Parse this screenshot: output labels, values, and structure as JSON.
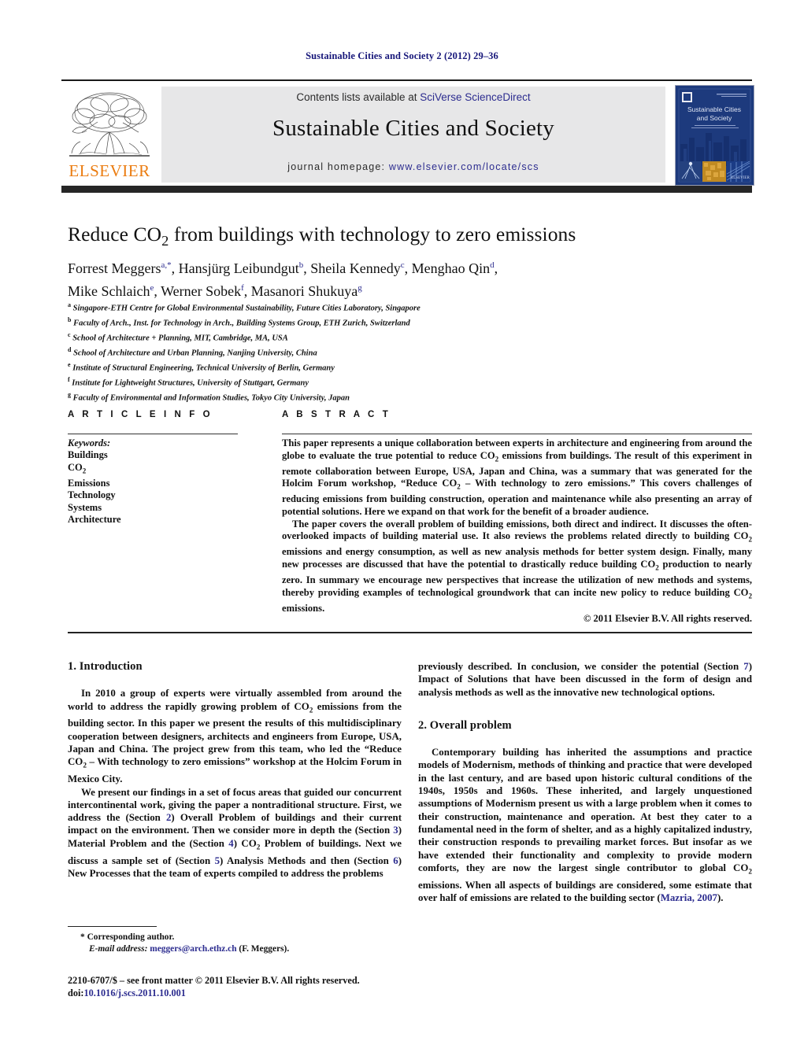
{
  "running_head": "Sustainable Cities and Society 2 (2012) 29–36",
  "header": {
    "contents_text": "Contents lists available at ",
    "sciverse_link": "SciVerse ScienceDirect",
    "journal_name": "Sustainable Cities and Society",
    "homepage_label": "journal homepage: ",
    "homepage_url": "www.elsevier.com/locate/scs",
    "publisher_wordmark": "ELSEVIER",
    "cover_title_line1": "Sustainable Cities",
    "cover_title_line2": "and Society",
    "accent_color": "#2c2c8f",
    "elsevier_orange": "#eb7c10",
    "banner_bg": "#e7e7e8"
  },
  "article": {
    "title_part1": "Reduce CO",
    "title_sub": "2",
    "title_part2": " from buildings with technology to zero emissions",
    "authors_line1": "Forrest Meggers",
    "authors": [
      {
        "name": "Forrest Meggers",
        "marks": "a,*"
      },
      {
        "name": "Hansjürg Leibundgut",
        "marks": "b"
      },
      {
        "name": "Sheila Kennedy",
        "marks": "c"
      },
      {
        "name": "Menghao Qin",
        "marks": "d"
      },
      {
        "name": "Mike Schlaich",
        "marks": "e"
      },
      {
        "name": "Werner Sobek",
        "marks": "f"
      },
      {
        "name": "Masanori Shukuya",
        "marks": "g"
      }
    ],
    "affiliations": [
      {
        "mark": "a",
        "text": "Singapore-ETH Centre for Global Environmental Sustainability, Future Cities Laboratory, Singapore"
      },
      {
        "mark": "b",
        "text": "Faculty of Arch., Inst. for Technology in Arch., Building Systems Group, ETH Zurich, Switzerland"
      },
      {
        "mark": "c",
        "text": "School of Architecture + Planning, MIT, Cambridge, MA, USA"
      },
      {
        "mark": "d",
        "text": "School of Architecture and Urban Planning, Nanjing University, China"
      },
      {
        "mark": "e",
        "text": "Institute of Structural Engineering, Technical University of Berlin, Germany"
      },
      {
        "mark": "f",
        "text": "Institute for Lightweight Structures, University of Stuttgart, Germany"
      },
      {
        "mark": "g",
        "text": "Faculty of Environmental and Information Studies, Tokyo City University, Japan"
      }
    ]
  },
  "info": {
    "heading": "A R T I C L E   I N F O",
    "keywords_label": "Keywords:",
    "keywords": [
      "Buildings",
      "CO2",
      "Emissions",
      "Technology",
      "Systems",
      "Architecture"
    ]
  },
  "abstract": {
    "heading": "A B S T R A C T",
    "paragraph1_a": "This paper represents a unique collaboration between experts in architecture and engineering from around the globe to evaluate the true potential to reduce CO",
    "paragraph1_b": " emissions from buildings. The result of this experiment in remote collaboration between Europe, USA, Japan and China, was a summary that was generated for the Holcim Forum workshop, “Reduce CO",
    "paragraph1_c": " – With technology to zero emissions.” This covers challenges of reducing emissions from building construction, operation and maintenance while also presenting an array of potential solutions. Here we expand on that work for the benefit of a broader audience.",
    "paragraph2_a": "The paper covers the overall problem of building emissions, both direct and indirect. It discusses the often-overlooked impacts of building material use. It also reviews the problems related directly to building CO",
    "paragraph2_b": " emissions and energy consumption, as well as new analysis methods for better system design. Finally, many new processes are discussed that have the potential to drastically reduce building CO",
    "paragraph2_c": " production to nearly zero. In summary we encourage new perspectives that increase the utilization of new methods and systems, thereby providing examples of technological groundwork that can incite new policy to reduce building CO",
    "paragraph2_d": " emissions.",
    "copyright": "© 2011 Elsevier B.V. All rights reserved."
  },
  "body": {
    "section1_heading": "1.  Introduction",
    "section1_p1_a": "In 2010 a group of experts were virtually assembled from around the world to address the rapidly growing problem of CO",
    "section1_p1_b": " emissions from the building sector. In this paper we present the results of this multidisciplinary cooperation between designers, architects and engineers from Europe, USA, Japan and China. The project grew from this team, who led the “Reduce CO",
    "section1_p1_c": " – With technology to zero emissions” workshop at the Holcim Forum in Mexico City.",
    "section1_p2_a": "We present our findings in a set of focus areas that guided our concurrent intercontinental work, giving the paper a nontraditional structure. First, we address the (Section ",
    "sec2_ref": "2",
    "section1_p2_b": ") Overall Problem of buildings and their current impact on the environment. Then we consider more in depth the (Section ",
    "sec3_ref": "3",
    "section1_p2_c": ") Material Problem and the (Section ",
    "sec4_ref": "4",
    "section1_p2_d": ") CO",
    "section1_p2_e": " Problem of buildings. Next we discuss a sample set of (Section ",
    "sec5_ref": "5",
    "section1_p2_f": ") Analysis Methods and then (Section ",
    "sec6_ref": "6",
    "section1_p2_g": ") New Processes that the team of experts compiled to address the problems",
    "section1_p2_h": "previously described. In conclusion, we consider the potential (Section ",
    "sec7_ref": "7",
    "section1_p2_i": ") Impact of Solutions that have been discussed in the form of design and analysis methods as well as the innovative new technological options.",
    "section2_heading": "2.  Overall problem",
    "section2_p1_a": "Contemporary building has inherited the assumptions and practice models of Modernism, methods of thinking and practice that were developed in the last century, and are based upon historic cultural conditions of the 1940s, 1950s and 1960s. These inherited, and largely unquestioned assumptions of Modernism present us with a large problem when it comes to their construction, maintenance and operation. At best they cater to a fundamental need in the form of shelter, and as a highly capitalized industry, their construction responds to prevailing market forces. But insofar as we have extended their functionality and complexity to provide modern comforts, they are now the largest single contributor to global CO",
    "section2_p1_b": " emissions. When all aspects of buildings are considered, some estimate that over half of emissions are related to the building sector (",
    "mazria_ref": "Mazria, 2007",
    "section2_p1_c": ")."
  },
  "footer": {
    "corresponding_marker": "*",
    "corresponding_label": "Corresponding author.",
    "email_label": "E-mail address:",
    "email": "meggers@arch.ethz.ch",
    "email_suffix": " (F. Meggers).",
    "issn_line": "2210-6707/$ – see front matter © 2011 Elsevier B.V. All rights reserved.",
    "doi_label": "doi:",
    "doi_value": "10.1016/j.scs.2011.10.001"
  }
}
